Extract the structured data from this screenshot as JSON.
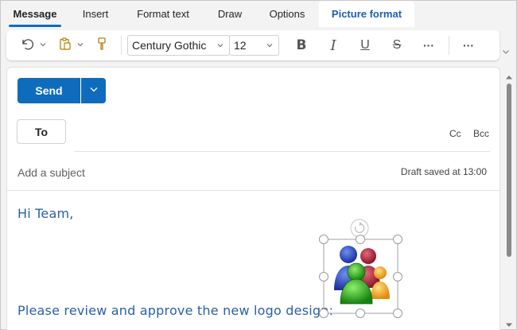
{
  "tabs": [
    {
      "label": "Message",
      "active": true
    },
    {
      "label": "Insert"
    },
    {
      "label": "Format text"
    },
    {
      "label": "Draw"
    },
    {
      "label": "Options"
    },
    {
      "label": "Picture format",
      "highlight": true
    }
  ],
  "toolbar": {
    "font_name": "Century Gothic",
    "font_size": "12",
    "more_label": "···",
    "overflow_label": "···",
    "icons": [
      "undo-icon",
      "paste-icon",
      "format-painter-icon",
      "bold-icon",
      "italic-icon",
      "underline-icon",
      "strikethrough-icon"
    ]
  },
  "compose": {
    "send_label": "Send",
    "to_label": "To",
    "cc_label": "Cc",
    "bcc_label": "Bcc",
    "subject_placeholder": "Add a subject",
    "draft_status": "Draft saved at 13:00",
    "body_greeting": "Hi Team,",
    "body_line": "Please review and approve the new logo design:"
  },
  "colors": {
    "accent": "#0f6cbd",
    "body_text": "#2a5fa8"
  }
}
